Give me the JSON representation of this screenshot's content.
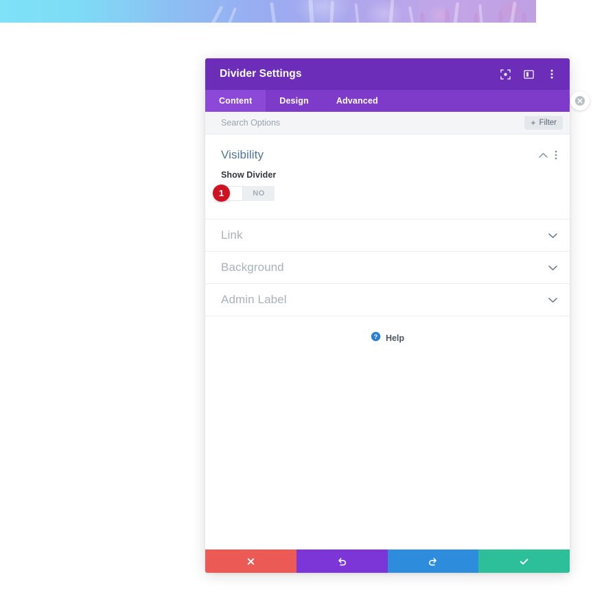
{
  "window": {
    "title": "Divider Settings"
  },
  "header": {
    "icons": [
      {
        "name": "focus-target-icon",
        "label": "Focus"
      },
      {
        "name": "panel-layout-icon",
        "label": "Layout"
      },
      {
        "name": "vertical-dots-icon",
        "label": "More options"
      }
    ]
  },
  "tabs": [
    {
      "label": "Content",
      "active": true
    },
    {
      "label": "Design",
      "active": false
    },
    {
      "label": "Advanced",
      "active": false
    }
  ],
  "close_button": {
    "label": "Close"
  },
  "search": {
    "placeholder": "Search Options",
    "value": "",
    "filter_label": "Filter",
    "filter_plus": "+"
  },
  "sections": {
    "visibility": {
      "title": "Visibility",
      "expanded": true,
      "field": {
        "label": "Show Divider",
        "toggle_value": "NO",
        "step_badge": "1"
      }
    },
    "collapsed": [
      {
        "title": "Link"
      },
      {
        "title": "Background"
      },
      {
        "title": "Admin Label"
      }
    ]
  },
  "help": {
    "label": "Help",
    "icon": "question-mark-circle-icon"
  },
  "footer": {
    "buttons": [
      {
        "name": "cancel-button",
        "icon": "cross-icon",
        "color": "#eb5a55"
      },
      {
        "name": "undo-button",
        "icon": "undo-icon",
        "color": "#7c35d6"
      },
      {
        "name": "redo-button",
        "icon": "redo-icon",
        "color": "#2d8cdb"
      },
      {
        "name": "save-button",
        "icon": "checkmark-icon",
        "color": "#2cbf9a"
      }
    ]
  },
  "colors": {
    "header_purple": "#6c2eb9",
    "tabbar_purple": "#7e3bc9",
    "tab_active_purple": "#8c48d6",
    "section_title_blue": "#4e7498",
    "badge_red": "#cf1124"
  }
}
